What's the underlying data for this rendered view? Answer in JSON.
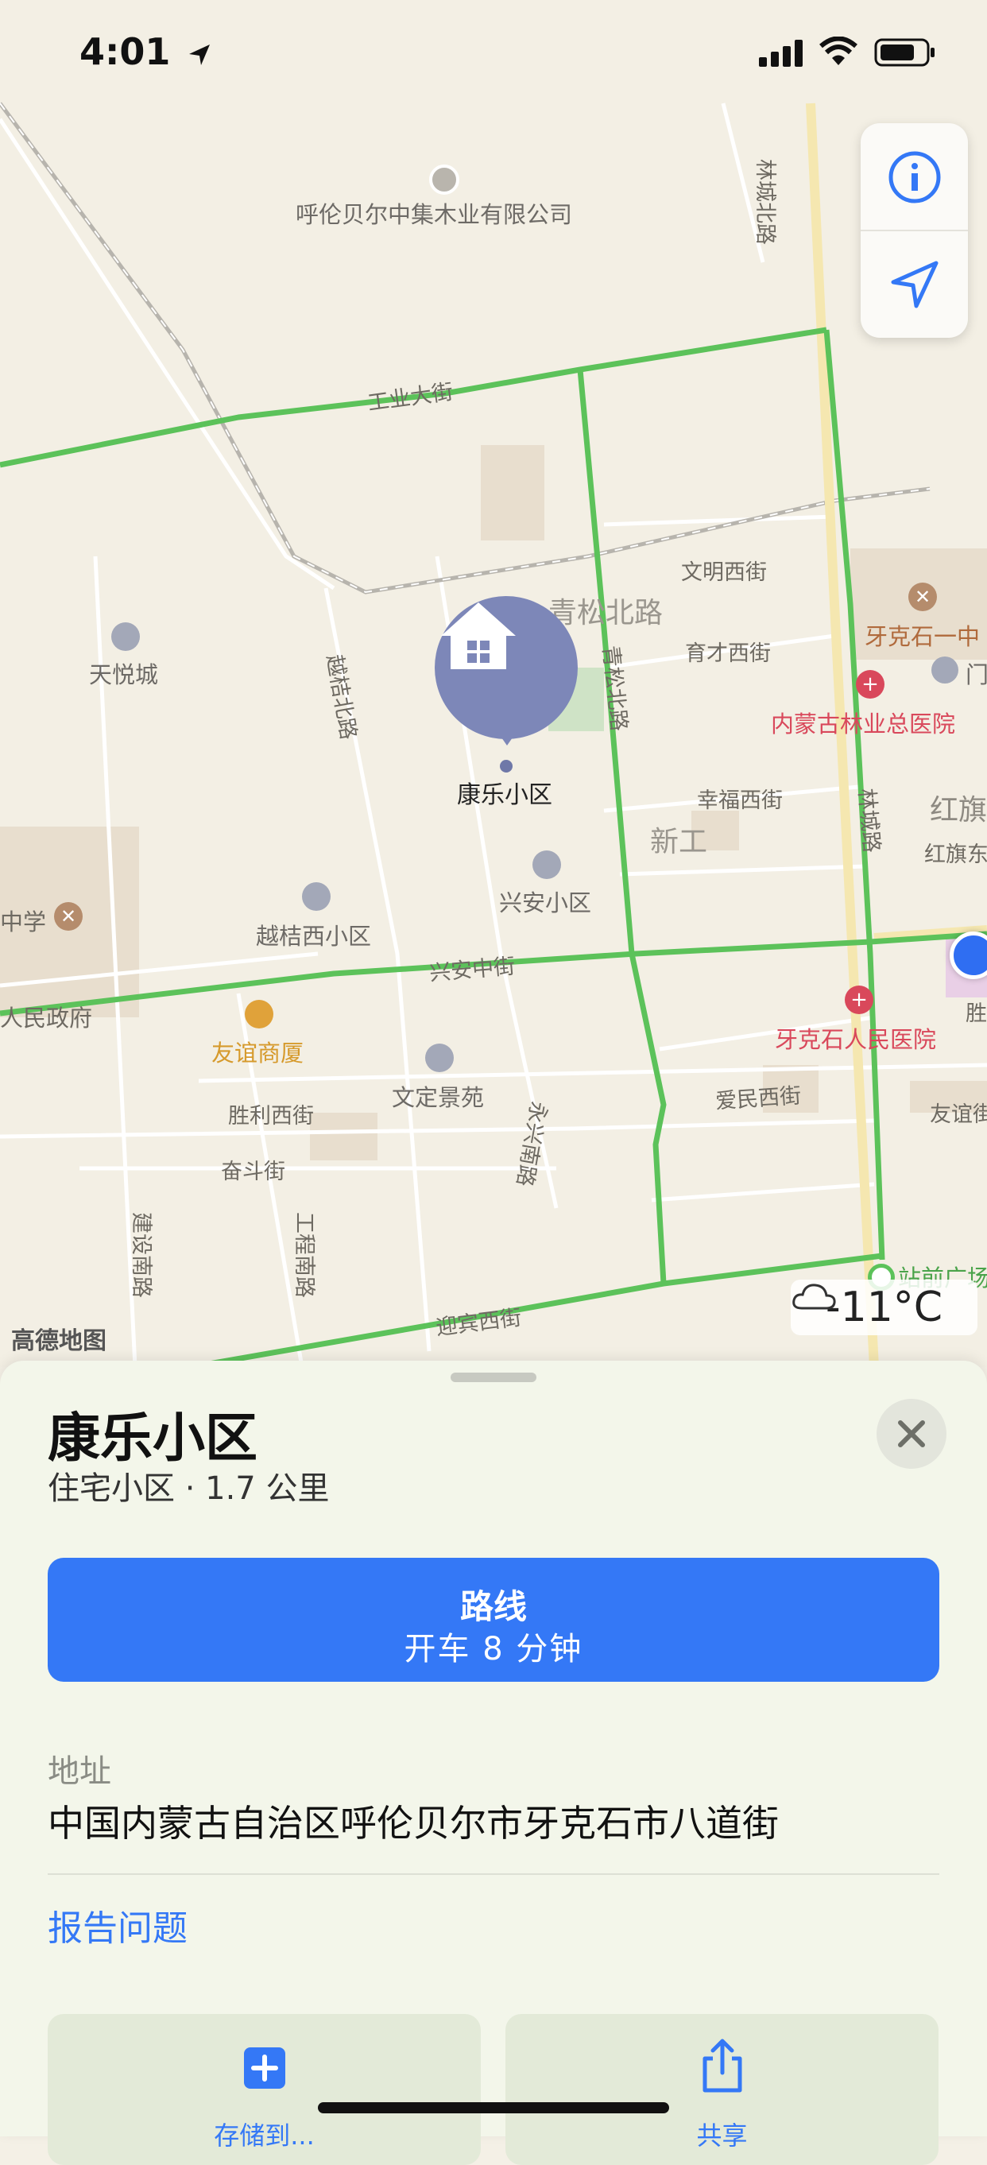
{
  "status_bar": {
    "time": "4:01"
  },
  "map": {
    "brand": "高德地图",
    "roads": [
      "工业大街",
      "林城北路",
      "文明西街",
      "青松北路",
      "青松北路",
      "育才西街",
      "越桔北路",
      "幸福西街",
      "林城路",
      "兴安中街",
      "胜利西街",
      "奋斗街",
      "爱民西街",
      "永兴南路",
      "建设南路",
      "工程南路",
      "迎宾西街",
      "红旗东",
      "友谊街",
      "胜"
    ],
    "areas": [
      "新工",
      "红旗"
    ],
    "pois": [
      {
        "name": "呼伦贝尔中集木业有限公司",
        "type": "company"
      },
      {
        "name": "天悦城",
        "type": "residential"
      },
      {
        "name": "牙克石一中",
        "type": "school"
      },
      {
        "name": "内蒙古林业总医院",
        "type": "hospital"
      },
      {
        "name": "兴安小区",
        "type": "residential"
      },
      {
        "name": "越桔西小区",
        "type": "residential"
      },
      {
        "name": "中学",
        "type": "school"
      },
      {
        "name": "人民政府",
        "type": "government"
      },
      {
        "name": "友谊商厦",
        "type": "shopping"
      },
      {
        "name": "文定景苑",
        "type": "residential"
      },
      {
        "name": "牙克石人民医院",
        "type": "hospital"
      },
      {
        "name": "站前广场",
        "type": "station"
      },
      {
        "name": "门",
        "type": "residential"
      }
    ],
    "selected_pin_label": "康乐小区",
    "weather": "-11°C"
  },
  "sheet": {
    "title": "康乐小区",
    "subtitle": "住宅小区 · 1.7 公里",
    "route_button": {
      "title": "路线",
      "detail": "开车 8 分钟"
    },
    "address_label": "地址",
    "address_value": "中国内蒙古自治区呼伦贝尔市牙克石市八道街",
    "report_link": "报告问题",
    "actions": [
      {
        "label": "存储到...",
        "icon": "plus-icon"
      },
      {
        "label": "共享",
        "icon": "share-icon"
      }
    ]
  },
  "colors": {
    "road_green": "#5cc25a",
    "accent_blue": "#3478f6",
    "pin_purple": "#7d87b8",
    "hospital_red": "#d9485b"
  }
}
